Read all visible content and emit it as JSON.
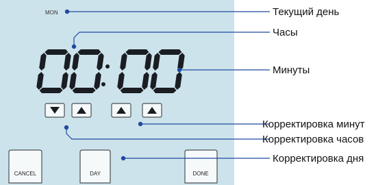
{
  "colors": {
    "panel": "#cde3ec",
    "lcd_segment": "#1a1d22",
    "leader_line": "#1f4aa0",
    "label_text": "#111111",
    "button_border": "#4a4f55"
  },
  "display": {
    "day": "MON",
    "hours_digits": [
      "0",
      "0"
    ],
    "minutes_digits": [
      "0",
      "0"
    ],
    "separator": "colon"
  },
  "arrow_buttons": [
    {
      "id": "hours-down",
      "direction": "down",
      "icon": "triangle-down-icon"
    },
    {
      "id": "hours-up",
      "direction": "up",
      "icon": "triangle-up-icon"
    },
    {
      "id": "minutes-up-1",
      "direction": "up",
      "icon": "triangle-up-icon"
    },
    {
      "id": "minutes-up-2",
      "direction": "up",
      "icon": "triangle-up-icon"
    }
  ],
  "buttons": {
    "cancel": "CANCEL",
    "day": "DAY",
    "done": "DONE"
  },
  "callouts": {
    "current_day": "Текущий день",
    "hours": "Часы",
    "minutes": "Минуты",
    "adjust_minutes": "Корректировка минут",
    "adjust_hours": "Корректировка часов",
    "adjust_day": "Корректировка дня"
  }
}
